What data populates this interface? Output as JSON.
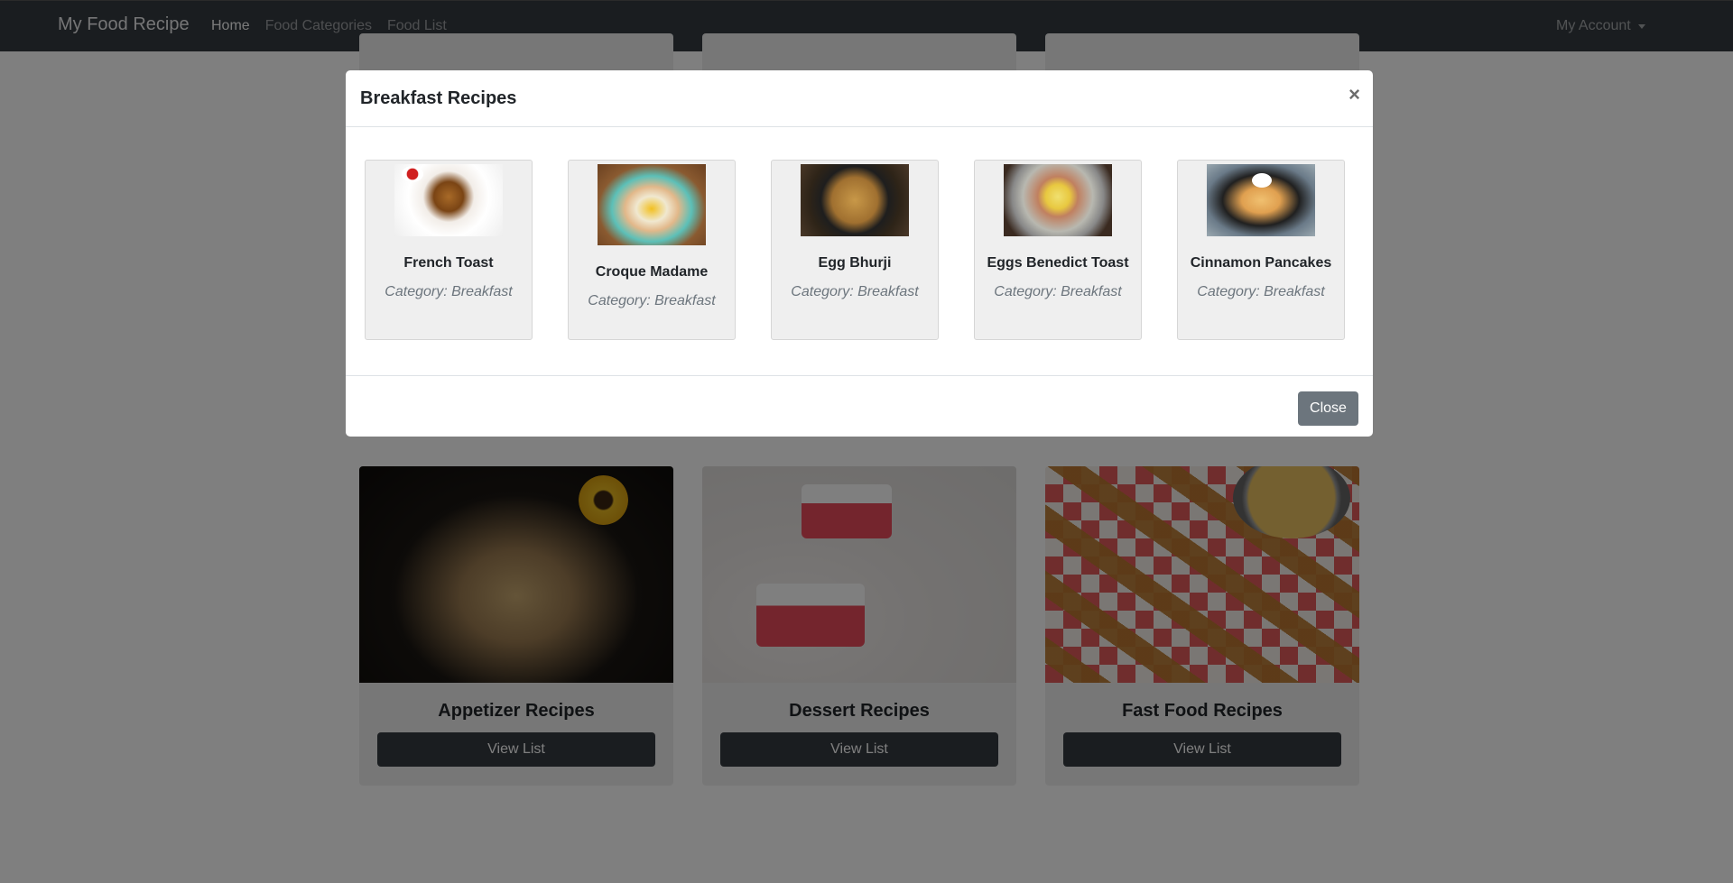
{
  "navbar": {
    "brand": "My Food Recipe",
    "links": [
      {
        "label": "Home",
        "active": true
      },
      {
        "label": "Food Categories",
        "active": false
      },
      {
        "label": "Food List",
        "active": false
      }
    ],
    "account_label": "My Account"
  },
  "categories": [
    {
      "title": "Appetizer Recipes",
      "button": "View List",
      "image": "appetizer-photo"
    },
    {
      "title": "Dessert Recipes",
      "button": "View List",
      "image": "dessert-photo"
    },
    {
      "title": "Fast Food Recipes",
      "button": "View List",
      "image": "fast-food-photo"
    }
  ],
  "modal": {
    "title": "Breakfast Recipes",
    "close_x": "×",
    "close_button": "Close",
    "recipes": [
      {
        "name": "French Toast",
        "category": "Category: Breakfast",
        "image": "french-toast-photo"
      },
      {
        "name": "Croque Madame",
        "category": "Category: Breakfast",
        "image": "croque-madame-photo"
      },
      {
        "name": "Egg Bhurji",
        "category": "Category: Breakfast",
        "image": "egg-bhurji-photo"
      },
      {
        "name": "Eggs Benedict Toast",
        "category": "Category: Breakfast",
        "image": "eggs-benedict-photo"
      },
      {
        "name": "Cinnamon Pancakes",
        "category": "Category: Breakfast",
        "image": "cinnamon-pancakes-photo"
      }
    ]
  }
}
